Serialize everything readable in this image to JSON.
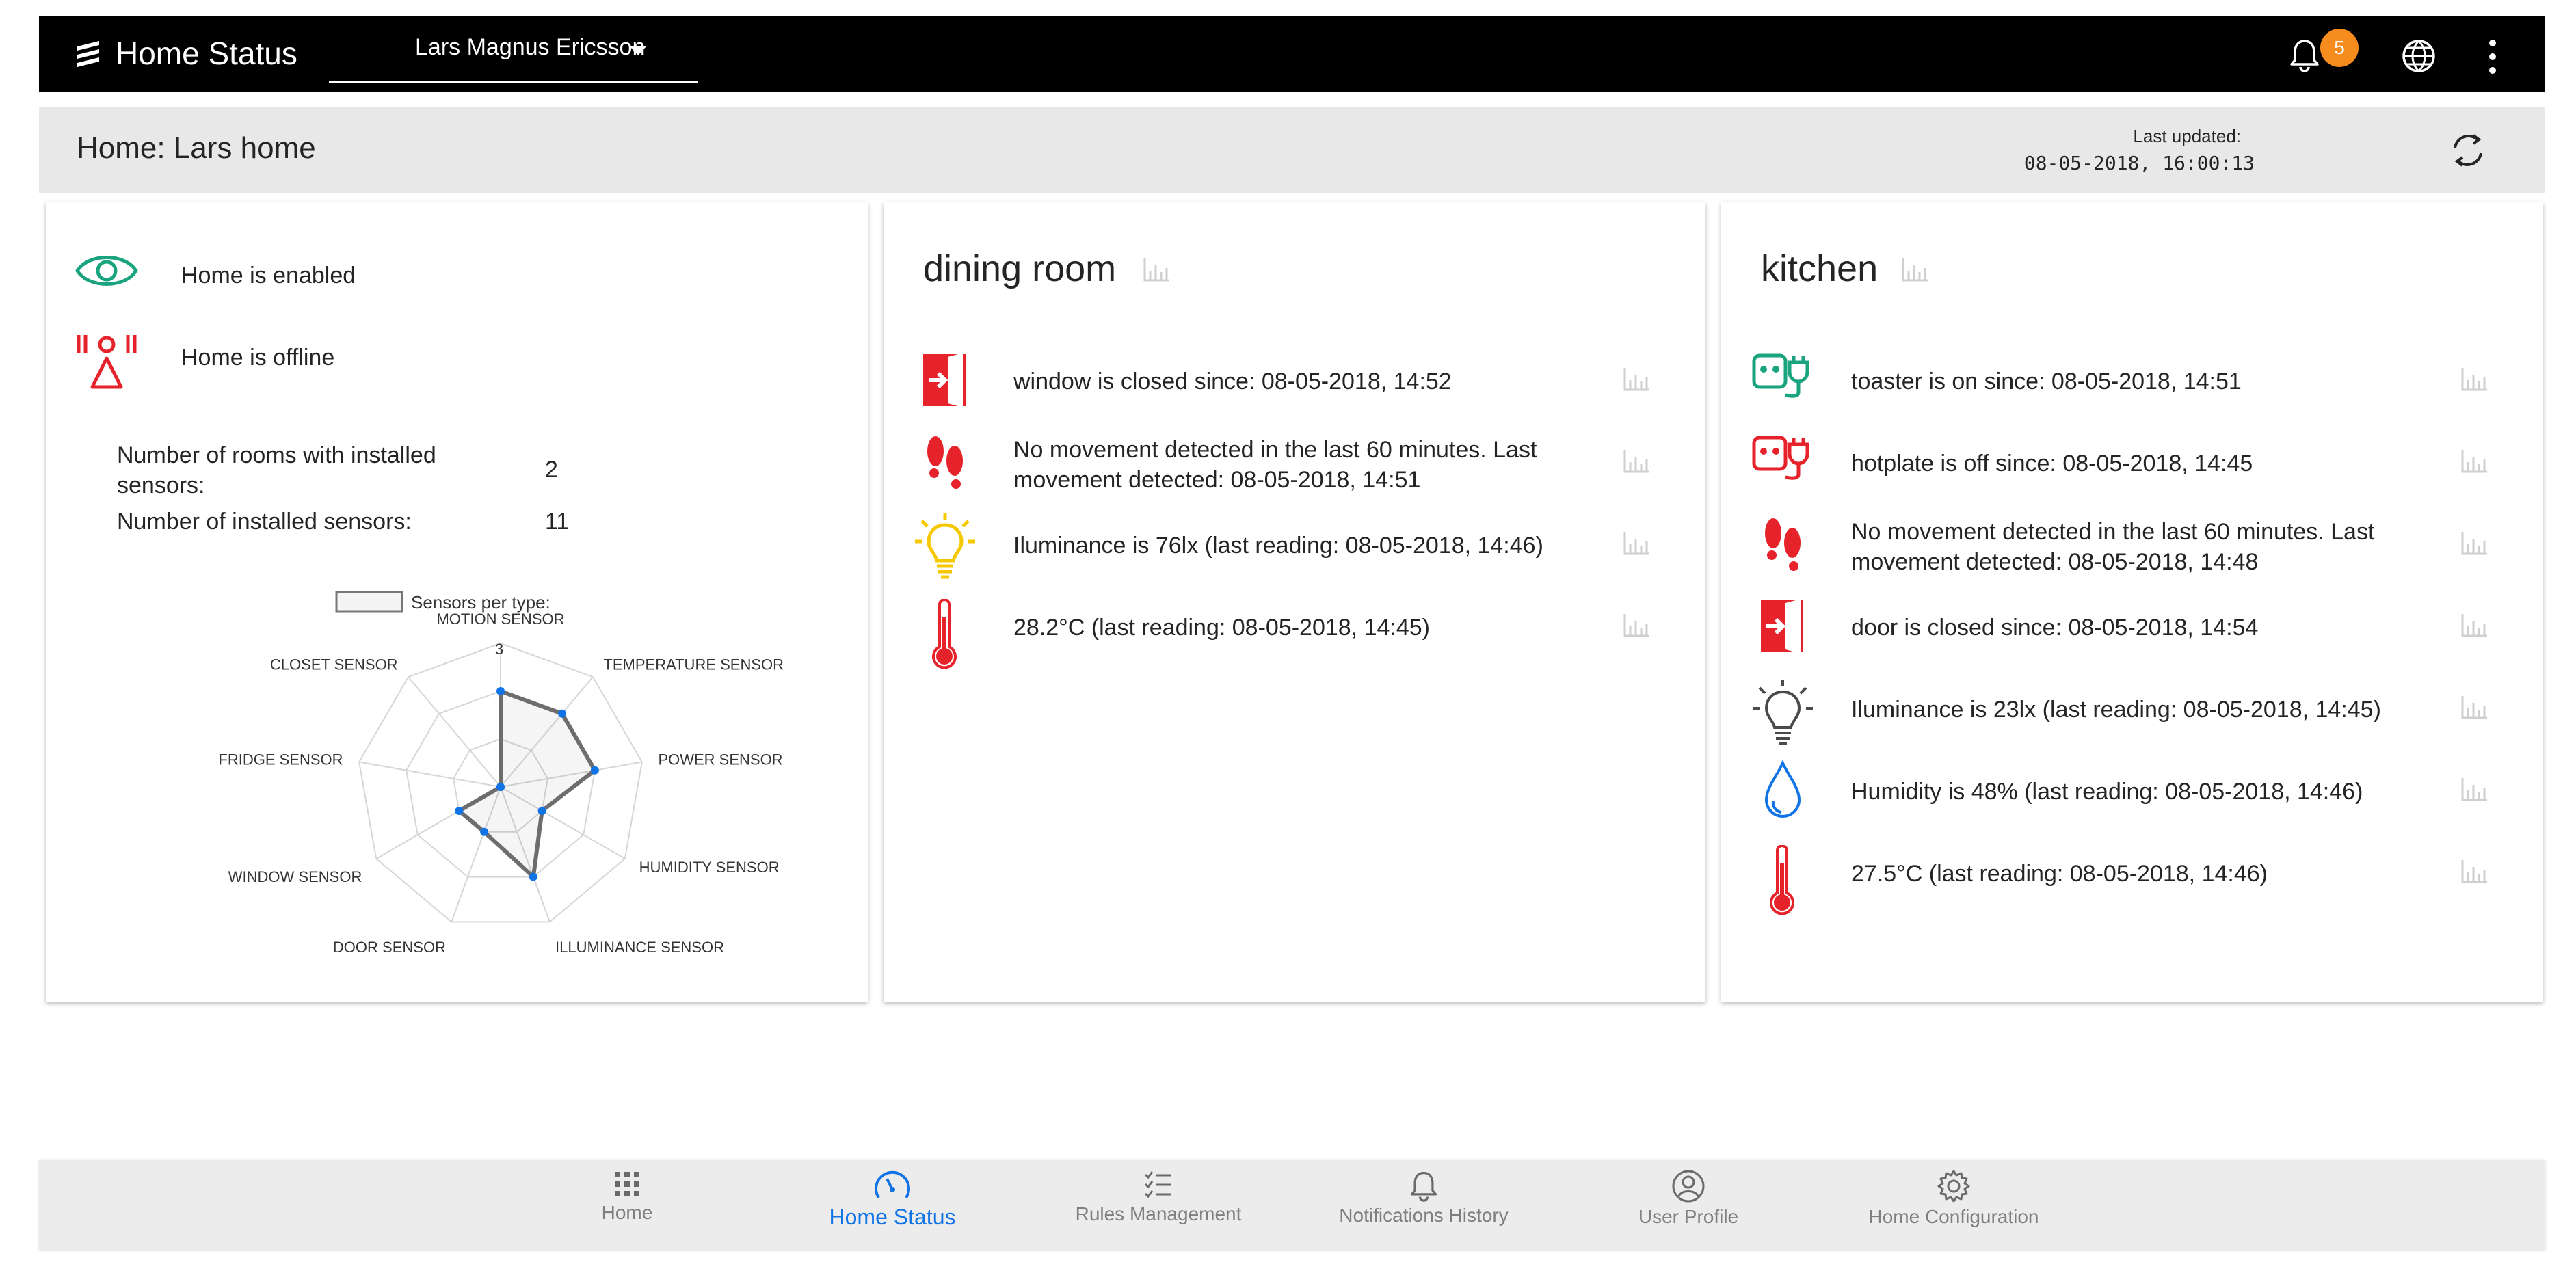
{
  "app": {
    "title": "Home Status",
    "user": "Lars Magnus Ericsson",
    "notification_count": "5"
  },
  "header": {
    "home_title": "Home: Lars home",
    "last_updated_label": "Last updated:",
    "last_updated_value": "08-05-2018, 16:00:13"
  },
  "summary": {
    "enabled_text": "Home is enabled",
    "offline_text": "Home is offline",
    "rooms_label": "Number of rooms with installed sensors:",
    "rooms_value": "2",
    "sensors_label": "Number of installed sensors:",
    "sensors_value": "11"
  },
  "chart_data": {
    "type": "radar",
    "legend": "Sensors per type:",
    "axis_max": 3,
    "axis_tick_label": "3",
    "categories": [
      "MOTION SENSOR",
      "TEMPERATURE SENSOR",
      "POWER SENSOR",
      "HUMIDITY SENSOR",
      "ILLUMINANCE SENSOR",
      "DOOR SENSOR",
      "WINDOW SENSOR",
      "FRIDGE SENSOR",
      "CLOSET SENSOR"
    ],
    "series": [
      {
        "values": [
          2,
          2,
          2,
          1,
          2,
          1,
          1,
          0,
          0
        ]
      }
    ],
    "colors": {
      "line": "#6d6d6d",
      "point": "#1174e6",
      "grid": "#d6d6d6"
    }
  },
  "dining": {
    "title": "dining room",
    "rows": [
      {
        "text": "window is closed since: 08-05-2018, 14:52",
        "icon": "door-exit-icon"
      },
      {
        "text": "No movement detected in the last 60 minutes.  Last movement detected: 08-05-2018, 14:51",
        "icon": "footprints-icon"
      },
      {
        "text": "Iluminance is 76lx (last reading: 08-05-2018, 14:46)",
        "icon": "lightbulb-on-icon"
      },
      {
        "text": "28.2°C (last reading: 08-05-2018, 14:45)",
        "icon": "thermometer-icon"
      }
    ]
  },
  "kitchen": {
    "title": "kitchen",
    "rows": [
      {
        "text": "toaster is on since: 08-05-2018, 14:51",
        "icon": "power-on-icon"
      },
      {
        "text": "hotplate is off since: 08-05-2018, 14:45",
        "icon": "power-off-icon"
      },
      {
        "text": "No movement detected in the last 60 minutes.  Last movement detected: 08-05-2018, 14:48",
        "icon": "footprints-icon"
      },
      {
        "text": "door is closed since: 08-05-2018, 14:54",
        "icon": "door-exit-icon"
      },
      {
        "text": "Iluminance is 23lx (last reading: 08-05-2018, 14:45)",
        "icon": "lightbulb-off-icon"
      },
      {
        "text": "Humidity is 48% (last reading: 08-05-2018, 14:46)",
        "icon": "droplet-icon"
      },
      {
        "text": "27.5°C (last reading: 08-05-2018, 14:46)",
        "icon": "thermometer-icon"
      }
    ]
  },
  "footer": {
    "nav": [
      {
        "label": "Home",
        "icon": "apps-grid-icon"
      },
      {
        "label": "Home Status",
        "icon": "speedometer-icon",
        "active": true
      },
      {
        "label": "Rules Management",
        "icon": "checklist-icon"
      },
      {
        "label": "Notifications History",
        "icon": "bell-icon"
      },
      {
        "label": "User Profile",
        "icon": "user-icon"
      },
      {
        "label": "Home Configuration",
        "icon": "gear-icon"
      }
    ]
  },
  "colors": {
    "accent": "#1174e6",
    "alert": "#e6232b",
    "enabled": "#19a37e",
    "badge": "#f68b1e",
    "lightbulb_on": "#f5c800"
  }
}
